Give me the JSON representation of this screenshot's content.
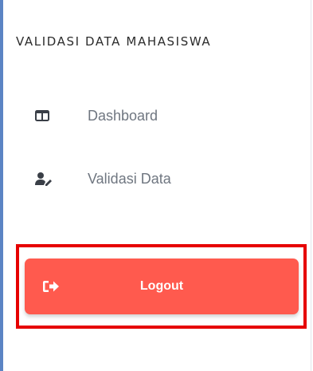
{
  "sidebar": {
    "brand": "VALIDASI DATA MAHASISWA",
    "items": [
      {
        "label": "Dashboard",
        "icon": "columns-icon"
      },
      {
        "label": "Validasi Data",
        "icon": "user-edit-icon"
      }
    ],
    "logout": {
      "label": "Logout",
      "icon": "sign-out-icon",
      "color": "#ff5a4e"
    },
    "highlight_color": "#e60000"
  }
}
